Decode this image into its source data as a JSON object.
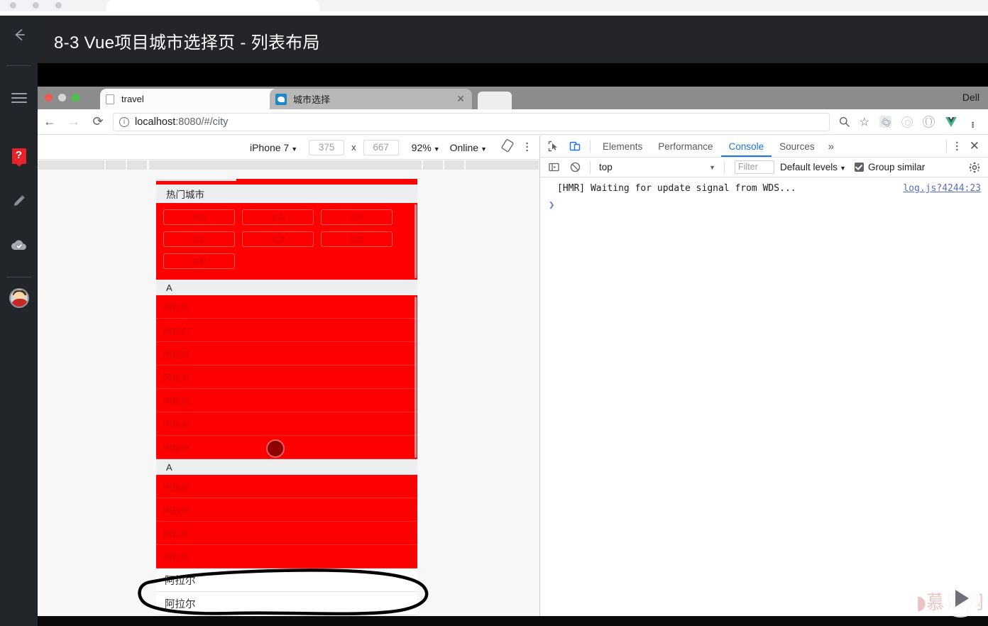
{
  "page": {
    "course_title": "8-3 Vue项目城市选择页 - 列表布局"
  },
  "rail": {
    "items": [
      {
        "name": "back-arrow",
        "label": "←"
      },
      {
        "name": "menu",
        "label": "≡"
      },
      {
        "name": "question-badge",
        "label": "?"
      },
      {
        "name": "pencil",
        "label": "✎"
      },
      {
        "name": "cloud-check",
        "label": "☁"
      },
      {
        "name": "avatar",
        "label": ""
      }
    ]
  },
  "browser": {
    "tabs": [
      {
        "title": "travel",
        "active": false,
        "close": "✕"
      },
      {
        "title": "城市选择",
        "active": true,
        "close": "✕"
      }
    ],
    "window_label": "Dell",
    "nav": {
      "back": "←",
      "forward": "→",
      "reload": "⟳"
    },
    "omnibox": {
      "info_icon": "ⓘ",
      "url_host": "localhost",
      "url_rest": ":8080/#/city",
      "full_url": "localhost:8080/#/city"
    },
    "extensions": [
      "search-icon",
      "star-icon",
      "react-devtools-icon",
      "camera-icon",
      "parens-icon",
      "vue-devtools-icon",
      "chrome-menu-icon"
    ]
  },
  "device_toolbar": {
    "device": "iPhone 7",
    "width": "375",
    "height": "667",
    "x_label": "x",
    "zoom": "92%",
    "throttling": "Online",
    "rotate_icon": "rotate-icon",
    "more_icon": "kebab-icon",
    "caret": "▼"
  },
  "app": {
    "hot_section_title": "热门城市",
    "hot_cities": [
      "北京",
      "北京",
      "北京",
      "北京",
      "北京",
      "北京",
      "北京"
    ],
    "letter_a": "A",
    "red_group_1": [
      "阿拉尔",
      "阿拉尔",
      "阿拉尔",
      "阿拉尔",
      "阿拉尔",
      "阿拉尔",
      "阿拉尔"
    ],
    "red_group_2": [
      "阿拉尔",
      "阿拉尔",
      "阿拉尔",
      "阿拉尔"
    ],
    "white_rows": [
      "阿拉尔",
      "阿拉尔"
    ],
    "colors": {
      "list_red": "#ff0000",
      "header_gray": "#eceef0",
      "text_red": "#cf0000"
    }
  },
  "devtools": {
    "tabs": [
      {
        "label": "Elements",
        "active": false
      },
      {
        "label": "Performance",
        "active": false
      },
      {
        "label": "Console",
        "active": true
      },
      {
        "label": "Sources",
        "active": false
      }
    ],
    "more_tabs": "»",
    "menu_icon": "kebab-icon",
    "close_icon": "✕",
    "inspect_icon": "inspect-element-icon",
    "device_icon": "toggle-device-toolbar-icon",
    "toolbar": {
      "sidebar_icon": "console-sidebar-icon",
      "clear_icon": "clear-console-icon",
      "context": "top",
      "context_caret": "▼",
      "filter_placeholder": "Filter",
      "levels": "Default levels",
      "levels_caret": "▼",
      "group_similar": "Group similar",
      "group_similar_checked": true,
      "settings_icon": "gear-icon"
    },
    "console_rows": [
      {
        "message": "[HMR] Waiting for update signal from WDS...",
        "source": "log.js?4244:23"
      }
    ],
    "prompt": "❯"
  },
  "player": {
    "play_icon": "play-button-icon",
    "watermark": "慕课网"
  }
}
